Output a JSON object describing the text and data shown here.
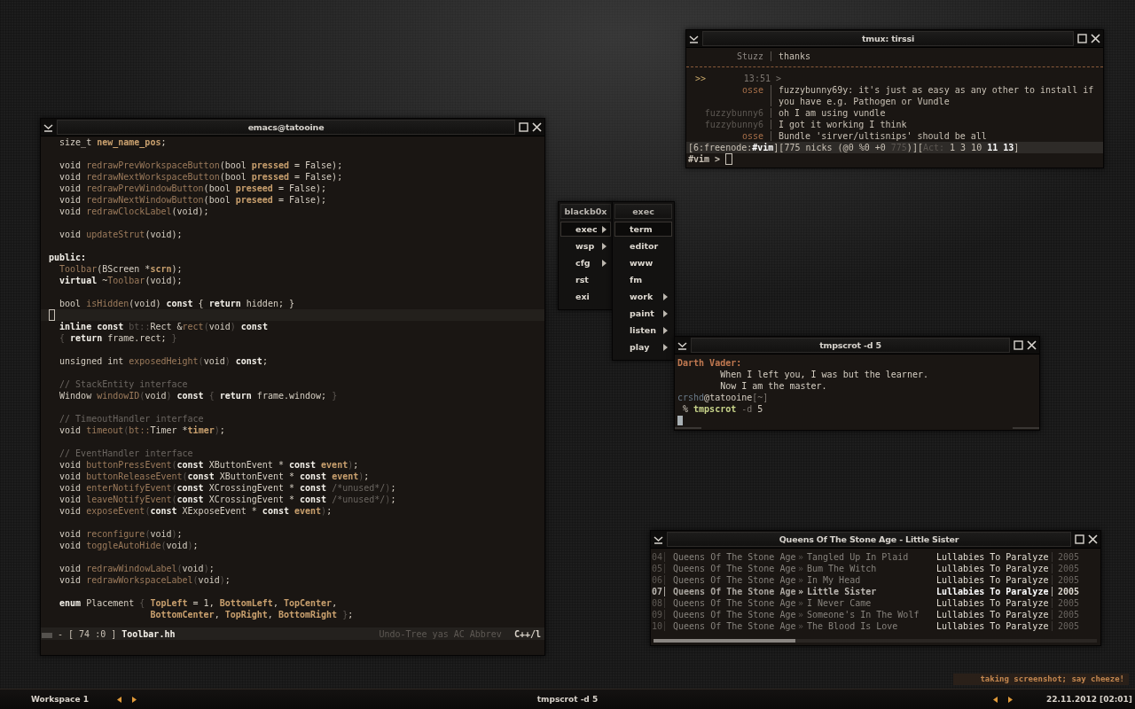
{
  "editor": {
    "title": "emacs@tatooine",
    "lines": [
      {
        "kind": "code",
        "tokens": [
          {
            "kind": "txt",
            "text": "  size_t "
          },
          {
            "kind": "var",
            "text": "new_name_pos"
          },
          {
            "kind": "txt",
            "text": ";"
          }
        ]
      },
      {
        "kind": "blank"
      },
      {
        "kind": "code",
        "tokens": [
          {
            "kind": "txt",
            "text": "  void "
          },
          {
            "kind": "fn",
            "text": "redrawPrevWorkspaceButton"
          },
          {
            "kind": "txt",
            "text": "(bool "
          },
          {
            "kind": "var",
            "text": "pressed"
          },
          {
            "kind": "txt",
            "text": " = False);"
          }
        ]
      },
      {
        "kind": "code",
        "tokens": [
          {
            "kind": "txt",
            "text": "  void "
          },
          {
            "kind": "fn",
            "text": "redrawNextWorkspaceButton"
          },
          {
            "kind": "txt",
            "text": "(bool "
          },
          {
            "kind": "var",
            "text": "pressed"
          },
          {
            "kind": "txt",
            "text": " = False);"
          }
        ]
      },
      {
        "kind": "code",
        "tokens": [
          {
            "kind": "txt",
            "text": "  void "
          },
          {
            "kind": "fn",
            "text": "redrawPrevWindowButton"
          },
          {
            "kind": "txt",
            "text": "(bool "
          },
          {
            "kind": "var",
            "text": "preseed"
          },
          {
            "kind": "txt",
            "text": " = False);"
          }
        ]
      },
      {
        "kind": "code",
        "tokens": [
          {
            "kind": "txt",
            "text": "  void "
          },
          {
            "kind": "fn",
            "text": "redrawNextWindowButton"
          },
          {
            "kind": "txt",
            "text": "(bool "
          },
          {
            "kind": "var",
            "text": "preseed"
          },
          {
            "kind": "txt",
            "text": " = False);"
          }
        ]
      },
      {
        "kind": "code",
        "tokens": [
          {
            "kind": "txt",
            "text": "  void "
          },
          {
            "kind": "fn",
            "text": "redrawClockLabel"
          },
          {
            "kind": "txt",
            "text": "(void);"
          }
        ]
      },
      {
        "kind": "blank"
      },
      {
        "kind": "code",
        "tokens": [
          {
            "kind": "txt",
            "text": "  void "
          },
          {
            "kind": "fn",
            "text": "updateStrut"
          },
          {
            "kind": "txt",
            "text": "(void);"
          }
        ]
      },
      {
        "kind": "blank"
      },
      {
        "kind": "code",
        "tokens": [
          {
            "kind": "kw",
            "text": "public:"
          }
        ]
      },
      {
        "kind": "code",
        "tokens": [
          {
            "kind": "fn",
            "text": "  Toolbar"
          },
          {
            "kind": "txt",
            "text": "(BScreen *"
          },
          {
            "kind": "var",
            "text": "scrn"
          },
          {
            "kind": "txt",
            "text": ");"
          }
        ]
      },
      {
        "kind": "code",
        "tokens": [
          {
            "kind": "kw",
            "text": "  virtual"
          },
          {
            "kind": "txt",
            "text": " ~"
          },
          {
            "kind": "fn",
            "text": "Toolbar"
          },
          {
            "kind": "txt",
            "text": "(void);"
          }
        ]
      },
      {
        "kind": "blank"
      },
      {
        "kind": "code",
        "tokens": [
          {
            "kind": "txt",
            "text": "  bool "
          },
          {
            "kind": "fn",
            "text": "isHidden"
          },
          {
            "kind": "txt",
            "text": "(void) "
          },
          {
            "kind": "kw",
            "text": "const"
          },
          {
            "kind": "txt",
            "text": " { "
          },
          {
            "kind": "kw",
            "text": "return"
          },
          {
            "kind": "txt",
            "text": " hidden; }"
          }
        ]
      },
      {
        "kind": "cursor"
      },
      {
        "kind": "code",
        "tokens": [
          {
            "kind": "kw",
            "text": "  inline const"
          },
          {
            "kind": "dim",
            "text": " bt::"
          },
          {
            "kind": "txt",
            "text": "Rect &"
          },
          {
            "kind": "fn",
            "text": "rect"
          },
          {
            "kind": "dim",
            "text": "("
          },
          {
            "kind": "txt",
            "text": "void"
          },
          {
            "kind": "dim",
            "text": ")"
          },
          {
            "kind": "kw",
            "text": " const"
          }
        ]
      },
      {
        "kind": "code",
        "tokens": [
          {
            "kind": "dim",
            "text": "  {"
          },
          {
            "kind": "kw",
            "text": " return"
          },
          {
            "kind": "txt",
            "text": " frame.rect; "
          },
          {
            "kind": "dim",
            "text": "}"
          }
        ]
      },
      {
        "kind": "blank"
      },
      {
        "kind": "code",
        "tokens": [
          {
            "kind": "txt",
            "text": "  unsigned int "
          },
          {
            "kind": "fn",
            "text": "exposedHeight"
          },
          {
            "kind": "dim",
            "text": "("
          },
          {
            "kind": "txt",
            "text": "void"
          },
          {
            "kind": "dim",
            "text": ")"
          },
          {
            "kind": "kw",
            "text": " const"
          },
          {
            "kind": "txt",
            "text": ";"
          }
        ]
      },
      {
        "kind": "blank"
      },
      {
        "kind": "code",
        "tokens": [
          {
            "kind": "cmt",
            "text": "  // StackEntity interface"
          }
        ]
      },
      {
        "kind": "code",
        "tokens": [
          {
            "kind": "txt",
            "text": "  Window "
          },
          {
            "kind": "fn",
            "text": "windowID"
          },
          {
            "kind": "dim",
            "text": "("
          },
          {
            "kind": "txt",
            "text": "void"
          },
          {
            "kind": "dim",
            "text": ")"
          },
          {
            "kind": "kw",
            "text": " const"
          },
          {
            "kind": "dim",
            "text": " {"
          },
          {
            "kind": "kw",
            "text": " return"
          },
          {
            "kind": "txt",
            "text": " frame.window; "
          },
          {
            "kind": "dim",
            "text": "}"
          }
        ]
      },
      {
        "kind": "blank"
      },
      {
        "kind": "code",
        "tokens": [
          {
            "kind": "cmt",
            "text": "  // TimeoutHandler interface"
          }
        ]
      },
      {
        "kind": "code",
        "tokens": [
          {
            "kind": "txt",
            "text": "  void "
          },
          {
            "kind": "fn",
            "text": "timeout"
          },
          {
            "kind": "dim",
            "text": "("
          },
          {
            "kind": "fn",
            "text": "bt::"
          },
          {
            "kind": "txt",
            "text": "Timer *"
          },
          {
            "kind": "var",
            "text": "timer"
          },
          {
            "kind": "dim",
            "text": ")"
          },
          {
            "kind": "txt",
            "text": ";"
          }
        ]
      },
      {
        "kind": "blank"
      },
      {
        "kind": "code",
        "tokens": [
          {
            "kind": "cmt",
            "text": "  // EventHandler interface"
          }
        ]
      },
      {
        "kind": "code",
        "tokens": [
          {
            "kind": "txt",
            "text": "  void "
          },
          {
            "kind": "fn",
            "text": "buttonPressEvent"
          },
          {
            "kind": "dim",
            "text": "("
          },
          {
            "kind": "kw",
            "text": "const"
          },
          {
            "kind": "txt",
            "text": " XButtonEvent * "
          },
          {
            "kind": "kw",
            "text": "const"
          },
          {
            "kind": "var",
            "text": " event"
          },
          {
            "kind": "dim",
            "text": ")"
          },
          {
            "kind": "txt",
            "text": ";"
          }
        ]
      },
      {
        "kind": "code",
        "tokens": [
          {
            "kind": "txt",
            "text": "  void "
          },
          {
            "kind": "fn",
            "text": "buttonReleaseEvent"
          },
          {
            "kind": "dim",
            "text": "("
          },
          {
            "kind": "kw",
            "text": "const"
          },
          {
            "kind": "txt",
            "text": " XButtonEvent * "
          },
          {
            "kind": "kw",
            "text": "const"
          },
          {
            "kind": "var",
            "text": " event"
          },
          {
            "kind": "dim",
            "text": ")"
          },
          {
            "kind": "txt",
            "text": ";"
          }
        ]
      },
      {
        "kind": "code",
        "tokens": [
          {
            "kind": "txt",
            "text": "  void "
          },
          {
            "kind": "fn",
            "text": "enterNotifyEvent"
          },
          {
            "kind": "dim",
            "text": "("
          },
          {
            "kind": "kw",
            "text": "const"
          },
          {
            "kind": "txt",
            "text": " XCrossingEvent * "
          },
          {
            "kind": "kw",
            "text": "const"
          },
          {
            "kind": "cmt",
            "text": " /*unused*/"
          },
          {
            "kind": "dim",
            "text": ")"
          },
          {
            "kind": "txt",
            "text": ";"
          }
        ]
      },
      {
        "kind": "code",
        "tokens": [
          {
            "kind": "txt",
            "text": "  void "
          },
          {
            "kind": "fn",
            "text": "leaveNotifyEvent"
          },
          {
            "kind": "dim",
            "text": "("
          },
          {
            "kind": "kw",
            "text": "const"
          },
          {
            "kind": "txt",
            "text": " XCrossingEvent * "
          },
          {
            "kind": "kw",
            "text": "const"
          },
          {
            "kind": "cmt",
            "text": " /*unused*/"
          },
          {
            "kind": "dim",
            "text": ")"
          },
          {
            "kind": "txt",
            "text": ";"
          }
        ]
      },
      {
        "kind": "code",
        "tokens": [
          {
            "kind": "txt",
            "text": "  void "
          },
          {
            "kind": "fn",
            "text": "exposeEvent"
          },
          {
            "kind": "dim",
            "text": "("
          },
          {
            "kind": "kw",
            "text": "const"
          },
          {
            "kind": "txt",
            "text": " XExposeEvent * "
          },
          {
            "kind": "kw",
            "text": "const"
          },
          {
            "kind": "var",
            "text": " event"
          },
          {
            "kind": "dim",
            "text": ")"
          },
          {
            "kind": "txt",
            "text": ";"
          }
        ]
      },
      {
        "kind": "blank"
      },
      {
        "kind": "code",
        "tokens": [
          {
            "kind": "txt",
            "text": "  void "
          },
          {
            "kind": "fn",
            "text": "reconfigure"
          },
          {
            "kind": "dim",
            "text": "("
          },
          {
            "kind": "txt",
            "text": "void"
          },
          {
            "kind": "dim",
            "text": ")"
          },
          {
            "kind": "txt",
            "text": ";"
          }
        ]
      },
      {
        "kind": "code",
        "tokens": [
          {
            "kind": "txt",
            "text": "  void "
          },
          {
            "kind": "fn",
            "text": "toggleAutoHide"
          },
          {
            "kind": "dim",
            "text": "("
          },
          {
            "kind": "txt",
            "text": "void"
          },
          {
            "kind": "dim",
            "text": ")"
          },
          {
            "kind": "txt",
            "text": ";"
          }
        ]
      },
      {
        "kind": "blank"
      },
      {
        "kind": "code",
        "tokens": [
          {
            "kind": "txt",
            "text": "  void "
          },
          {
            "kind": "fn",
            "text": "redrawWindowLabel"
          },
          {
            "kind": "dim",
            "text": "("
          },
          {
            "kind": "txt",
            "text": "void"
          },
          {
            "kind": "dim",
            "text": ")"
          },
          {
            "kind": "txt",
            "text": ";"
          }
        ]
      },
      {
        "kind": "code",
        "tokens": [
          {
            "kind": "txt",
            "text": "  void "
          },
          {
            "kind": "fn",
            "text": "redrawWorkspaceLabel"
          },
          {
            "kind": "dim",
            "text": "("
          },
          {
            "kind": "txt",
            "text": "void"
          },
          {
            "kind": "dim",
            "text": ")"
          },
          {
            "kind": "txt",
            "text": ";"
          }
        ]
      },
      {
        "kind": "blank"
      },
      {
        "kind": "code",
        "tokens": [
          {
            "kind": "kw",
            "text": "  enum"
          },
          {
            "kind": "txt",
            "text": " Placement "
          },
          {
            "kind": "dim",
            "text": "{"
          },
          {
            "kind": "var",
            "text": " TopLeft"
          },
          {
            "kind": "txt",
            "text": " = 1, "
          },
          {
            "kind": "var",
            "text": "BottomLeft"
          },
          {
            "kind": "txt",
            "text": ", "
          },
          {
            "kind": "var",
            "text": "TopCenter"
          },
          {
            "kind": "txt",
            "text": ","
          }
        ]
      },
      {
        "kind": "code",
        "tokens": [
          {
            "kind": "var",
            "text": "                   BottomCenter"
          },
          {
            "kind": "txt",
            "text": ", "
          },
          {
            "kind": "var",
            "text": "TopRight"
          },
          {
            "kind": "txt",
            "text": ", "
          },
          {
            "kind": "var",
            "text": "BottomRight"
          },
          {
            "kind": "dim",
            "text": " }"
          },
          {
            "kind": "txt",
            "text": ";"
          }
        ]
      }
    ],
    "mode_line": {
      "position": "- [ 74 :0 ]",
      "buffer": "Toolbar.hh",
      "modes": "Undo-Tree yas AC Abbrev",
      "major_mode": "C++/l"
    }
  },
  "irc": {
    "title": "tmux: tirssi",
    "scrollback": [
      {
        "nick": "Stuzz",
        "color": "#8a8580",
        "text": "thanks"
      }
    ],
    "marker": {
      "prompt": ">>",
      "time": "13:51 >"
    },
    "messages": [
      {
        "nick": "osse",
        "color": "#a8704a",
        "text": "fuzzybunny69y: it's just as easy as any other to install if you have e.g. Pathogen or Vundle"
      },
      {
        "nick": "fuzzybunny6",
        "color": "#5c5752",
        "text": "oh I am using vundle"
      },
      {
        "nick": "fuzzybunny6",
        "color": "#5c5752",
        "text": "I got it working I think"
      },
      {
        "nick": "osse",
        "color": "#a8704a",
        "text": "Bundle 'sirver/ultisnips' should be all"
      }
    ],
    "status": [
      {
        "kind": "txt",
        "text": "[6:freenode:"
      },
      {
        "kind": "bold",
        "text": "#vim"
      },
      {
        "kind": "txt",
        "text": "][775 nicks (@0 %0 +0 "
      },
      {
        "kind": "dim",
        "text": "775"
      },
      {
        "kind": "txt",
        "text": ")]["
      },
      {
        "kind": "dim",
        "text": "Act:"
      },
      {
        "kind": "txt",
        "text": " 1 3 10 "
      },
      {
        "kind": "bold",
        "text": "11 13"
      },
      {
        "kind": "txt",
        "text": "]"
      }
    ],
    "prompt": "#vim >"
  },
  "menu": {
    "title": "blackb0x",
    "items": [
      {
        "label": "exec",
        "submenu": true,
        "selected": true
      },
      {
        "label": "wsp",
        "submenu": true,
        "selected": false
      },
      {
        "label": "cfg",
        "submenu": true,
        "selected": false
      },
      {
        "label": "rst",
        "submenu": false,
        "selected": false
      },
      {
        "label": "exi",
        "submenu": false,
        "selected": false
      }
    ]
  },
  "submenu": {
    "title": "exec",
    "items": [
      {
        "label": "term",
        "submenu": false,
        "selected": true
      },
      {
        "label": "editor",
        "submenu": false,
        "selected": false
      },
      {
        "label": "www",
        "submenu": false,
        "selected": false
      },
      {
        "label": "fm",
        "submenu": false,
        "selected": false
      },
      {
        "label": "work",
        "submenu": true,
        "selected": false
      },
      {
        "label": "paint",
        "submenu": true,
        "selected": false
      },
      {
        "label": "listen",
        "submenu": true,
        "selected": false
      },
      {
        "label": "play",
        "submenu": true,
        "selected": false
      }
    ]
  },
  "terminal": {
    "title": "tmpscrot -d 5",
    "lines": [
      {
        "segments": [
          {
            "kind": "speaker",
            "text": "Darth Vader:"
          }
        ]
      },
      {
        "segments": [
          {
            "kind": "txt",
            "text": "        When I left you, I was but the learner."
          }
        ]
      },
      {
        "segments": [
          {
            "kind": "txt",
            "text": "        Now I am the master."
          }
        ]
      },
      {
        "segments": [
          {
            "kind": "user",
            "text": "crshd"
          },
          {
            "kind": "txt",
            "text": "@tatooine"
          },
          {
            "kind": "dim",
            "text": "[~]"
          }
        ]
      },
      {
        "segments": [
          {
            "kind": "txt",
            "text": " % "
          },
          {
            "kind": "cmd",
            "text": "tmpscrot"
          },
          {
            "kind": "dim",
            "text": " -d"
          },
          {
            "kind": "txt",
            "text": " 5"
          }
        ]
      }
    ]
  },
  "player": {
    "title": "Queens Of The Stone Age - Little Sister",
    "tracks": [
      {
        "number": "04",
        "artist": "Queens Of The Stone Age",
        "marker": "»",
        "title": "Tangled Up In Plaid",
        "album": "Lullabies To Paralyze",
        "year": "2005",
        "selected": false
      },
      {
        "number": "05",
        "artist": "Queens Of The Stone Age",
        "marker": "»",
        "title": "Bum The Witch",
        "album": "Lullabies To Paralyze",
        "year": "2005",
        "selected": false
      },
      {
        "number": "06",
        "artist": "Queens Of The Stone Age",
        "marker": "»",
        "title": "In My Head",
        "album": "Lullabies To Paralyze",
        "year": "2005",
        "selected": false
      },
      {
        "number": "07",
        "artist": "Queens Of The Stone Age",
        "marker": "»",
        "title": "Little Sister",
        "album": "Lullabies To Paralyze",
        "year": "2005",
        "selected": true
      },
      {
        "number": "08",
        "artist": "Queens Of The Stone Age",
        "marker": "»",
        "title": "I Never Came",
        "album": "Lullabies To Paralyze",
        "year": "2005",
        "selected": false
      },
      {
        "number": "09",
        "artist": "Queens Of The Stone Age",
        "marker": "»",
        "title": "Someone's In The Wolf",
        "album": "Lullabies To Paralyze",
        "year": "2005",
        "selected": false
      },
      {
        "number": "10",
        "artist": "Queens Of The Stone Age",
        "marker": "»",
        "title": "The Blood Is Love",
        "album": "Lullabies To Paralyze",
        "year": "2005",
        "selected": false
      }
    ],
    "progress": {
      "level": 0.32
    }
  },
  "notification": "taking screenshot; say cheeze!",
  "taskbar": {
    "workspace": "Workspace 1",
    "window_title": "tmpscrot -d 5",
    "clock": "22.11.2012 [02:01]"
  }
}
